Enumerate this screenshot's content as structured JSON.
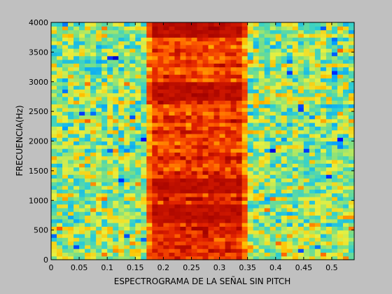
{
  "window": {
    "background": "#c0c0c0"
  },
  "chart_data": {
    "type": "heatmap",
    "title": "",
    "xlabel": "ESPECTROGRAMA DE LA SEÑAL SIN PITCH",
    "ylabel": "FRECUENCIA(Hz)",
    "xlim": [
      0,
      0.54
    ],
    "ylim": [
      0,
      4000
    ],
    "x_ticks": [
      0,
      0.05,
      0.1,
      0.15,
      0.2,
      0.25,
      0.3,
      0.35,
      0.4,
      0.45,
      0.5
    ],
    "x_tick_labels": [
      "0",
      "0.05",
      "0.1",
      "0.15",
      "0.2",
      "0.25",
      "0.3",
      "0.35",
      "0.4",
      "0.45",
      "0.5"
    ],
    "y_ticks": [
      0,
      500,
      1000,
      1500,
      2000,
      2500,
      3000,
      3500,
      4000
    ],
    "y_tick_labels": [
      "0",
      "500",
      "1000",
      "1500",
      "2000",
      "2500",
      "3000",
      "3500",
      "4000"
    ],
    "grid": false,
    "colormap": "jet",
    "colormap_stops": [
      "#000090",
      "#0000ff",
      "#00a0ff",
      "#30d0d0",
      "#80e080",
      "#e8f040",
      "#ffc000",
      "#ff6000",
      "#e02000",
      "#a00000"
    ],
    "time_bins": 54,
    "freq_bins": 64,
    "noise_level": 0.47,
    "noise_variation": 0.18,
    "high_energy_region": {
      "start_time": 0.17,
      "end_time": 0.355,
      "level": 0.85,
      "variation": 0.1
    },
    "banding": {
      "strong_bands_hz": [
        800,
        1250,
        2850,
        3900
      ],
      "strong_band_level": 0.95
    }
  }
}
